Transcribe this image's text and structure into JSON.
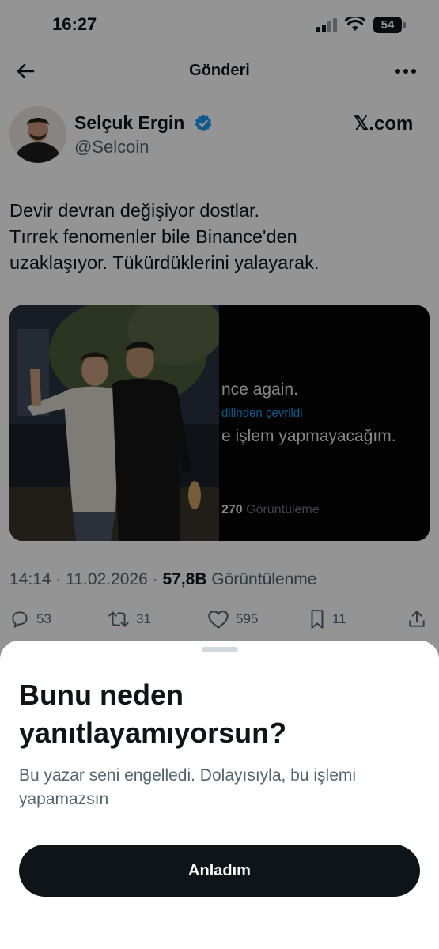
{
  "status_bar": {
    "time": "16:27",
    "battery": "54"
  },
  "header": {
    "title": "Gönderi"
  },
  "author": {
    "name": "Selçuk Ergin",
    "handle": "@Selcoin"
  },
  "source": {
    "label": "𝕏.com"
  },
  "tweet": {
    "lines": [
      "Devir devran değişiyor dostlar.",
      "Tırrek fenomenler bile Binance'den",
      "uzaklaşıyor. Tükürdüklerini yalayarak."
    ],
    "embedded_screenshot": {
      "line1": "nce again.",
      "translated": "dilinden çevrildi",
      "line2": "e işlem yapmayacağım.",
      "views_count": "270",
      "views_label": "Görüntüleme"
    }
  },
  "meta": {
    "time": "14:14",
    "separator": "·",
    "date": "11.02.2026",
    "views_count": "57,8B",
    "views_label": "Görüntülenme"
  },
  "actions": {
    "replies": "53",
    "reposts": "31",
    "likes": "595",
    "bookmarks": "11"
  },
  "sheet": {
    "title_line1": "Bunu neden",
    "title_line2": "yanıtlayamıyorsun?",
    "body_line1": "Bu yazar seni engelledi. Dolayısıyla, bu işlemi",
    "body_line2": "yapamazsın",
    "button_label": "Anladım"
  },
  "colors": {
    "text_primary": "#0f1419",
    "text_secondary": "#536471",
    "verified_blue": "#1d9bf0",
    "button_bg": "#0f1419"
  }
}
